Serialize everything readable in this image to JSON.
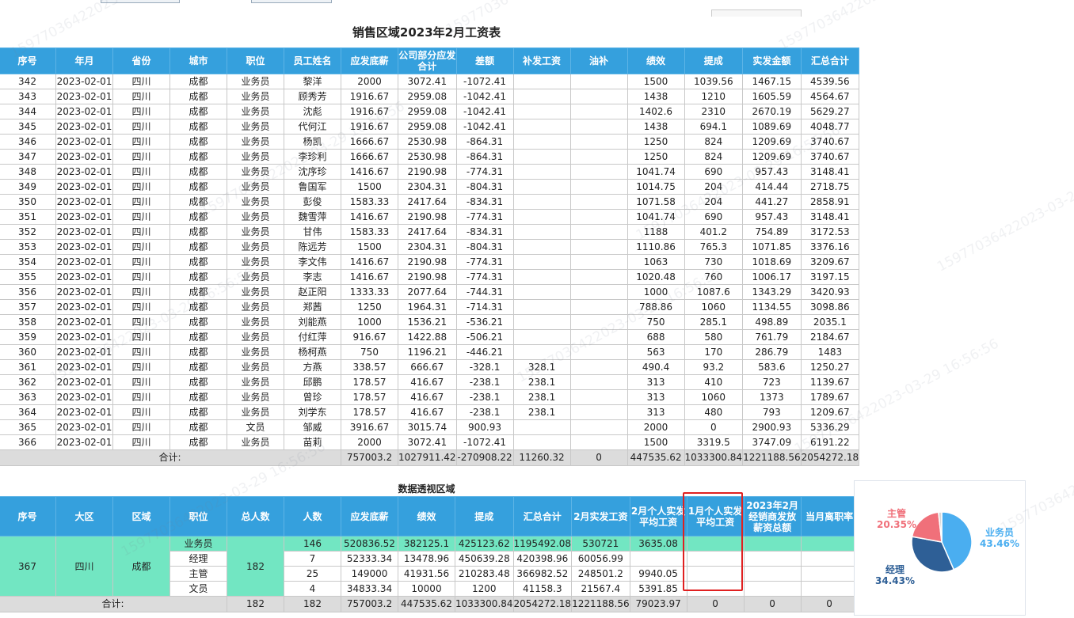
{
  "report_title": "销售区域2023年2月工资表",
  "pivot_title": "数据透视区域",
  "main": {
    "headers": [
      "序号",
      "年月",
      "省份",
      "城市",
      "职位",
      "员工姓名",
      "应发底薪",
      "公司部分应发合计",
      "差额",
      "补发工资",
      "油补",
      "绩效",
      "提成",
      "实发金额",
      "汇总合计"
    ],
    "rows": [
      [
        "342",
        "2023-02-01",
        "四川",
        "成都",
        "业务员",
        "黎洋",
        "2000",
        "3072.41",
        "-1072.41",
        "",
        "",
        "1500",
        "1039.56",
        "1467.15",
        "4539.56"
      ],
      [
        "343",
        "2023-02-01",
        "四川",
        "成都",
        "业务员",
        "顾秀芳",
        "1916.67",
        "2959.08",
        "-1042.41",
        "",
        "",
        "1438",
        "1210",
        "1605.59",
        "4564.67"
      ],
      [
        "344",
        "2023-02-01",
        "四川",
        "成都",
        "业务员",
        "沈彪",
        "1916.67",
        "2959.08",
        "-1042.41",
        "",
        "",
        "1402.6",
        "2310",
        "2670.19",
        "5629.27"
      ],
      [
        "345",
        "2023-02-01",
        "四川",
        "成都",
        "业务员",
        "代何江",
        "1916.67",
        "2959.08",
        "-1042.41",
        "",
        "",
        "1438",
        "694.1",
        "1089.69",
        "4048.77"
      ],
      [
        "346",
        "2023-02-01",
        "四川",
        "成都",
        "业务员",
        "杨凯",
        "1666.67",
        "2530.98",
        "-864.31",
        "",
        "",
        "1250",
        "824",
        "1209.69",
        "3740.67"
      ],
      [
        "347",
        "2023-02-01",
        "四川",
        "成都",
        "业务员",
        "李珍利",
        "1666.67",
        "2530.98",
        "-864.31",
        "",
        "",
        "1250",
        "824",
        "1209.69",
        "3740.67"
      ],
      [
        "348",
        "2023-02-01",
        "四川",
        "成都",
        "业务员",
        "沈序珍",
        "1416.67",
        "2190.98",
        "-774.31",
        "",
        "",
        "1041.74",
        "690",
        "957.43",
        "3148.41"
      ],
      [
        "349",
        "2023-02-01",
        "四川",
        "成都",
        "业务员",
        "鲁国军",
        "1500",
        "2304.31",
        "-804.31",
        "",
        "",
        "1014.75",
        "204",
        "414.44",
        "2718.75"
      ],
      [
        "350",
        "2023-02-01",
        "四川",
        "成都",
        "业务员",
        "彭俊",
        "1583.33",
        "2417.64",
        "-834.31",
        "",
        "",
        "1071.58",
        "204",
        "441.27",
        "2858.91"
      ],
      [
        "351",
        "2023-02-01",
        "四川",
        "成都",
        "业务员",
        "魏雪萍",
        "1416.67",
        "2190.98",
        "-774.31",
        "",
        "",
        "1041.74",
        "690",
        "957.43",
        "3148.41"
      ],
      [
        "352",
        "2023-02-01",
        "四川",
        "成都",
        "业务员",
        "甘伟",
        "1583.33",
        "2417.64",
        "-834.31",
        "",
        "",
        "1188",
        "401.2",
        "754.89",
        "3172.53"
      ],
      [
        "353",
        "2023-02-01",
        "四川",
        "成都",
        "业务员",
        "陈远芳",
        "1500",
        "2304.31",
        "-804.31",
        "",
        "",
        "1110.86",
        "765.3",
        "1071.85",
        "3376.16"
      ],
      [
        "354",
        "2023-02-01",
        "四川",
        "成都",
        "业务员",
        "李文伟",
        "1416.67",
        "2190.98",
        "-774.31",
        "",
        "",
        "1063",
        "730",
        "1018.69",
        "3209.67"
      ],
      [
        "355",
        "2023-02-01",
        "四川",
        "成都",
        "业务员",
        "李志",
        "1416.67",
        "2190.98",
        "-774.31",
        "",
        "",
        "1020.48",
        "760",
        "1006.17",
        "3197.15"
      ],
      [
        "356",
        "2023-02-01",
        "四川",
        "成都",
        "业务员",
        "赵正阳",
        "1333.33",
        "2077.64",
        "-744.31",
        "",
        "",
        "1000",
        "1087.6",
        "1343.29",
        "3420.93"
      ],
      [
        "357",
        "2023-02-01",
        "四川",
        "成都",
        "业务员",
        "郑茜",
        "1250",
        "1964.31",
        "-714.31",
        "",
        "",
        "788.86",
        "1060",
        "1134.55",
        "3098.86"
      ],
      [
        "358",
        "2023-02-01",
        "四川",
        "成都",
        "业务员",
        "刘能燕",
        "1000",
        "1536.21",
        "-536.21",
        "",
        "",
        "750",
        "285.1",
        "498.89",
        "2035.1"
      ],
      [
        "359",
        "2023-02-01",
        "四川",
        "成都",
        "业务员",
        "付红萍",
        "916.67",
        "1422.88",
        "-506.21",
        "",
        "",
        "688",
        "580",
        "761.79",
        "2184.67"
      ],
      [
        "360",
        "2023-02-01",
        "四川",
        "成都",
        "业务员",
        "杨柯燕",
        "750",
        "1196.21",
        "-446.21",
        "",
        "",
        "563",
        "170",
        "286.79",
        "1483"
      ],
      [
        "361",
        "2023-02-01",
        "四川",
        "成都",
        "业务员",
        "方燕",
        "338.57",
        "666.67",
        "-328.1",
        "328.1",
        "",
        "490.4",
        "93.2",
        "583.6",
        "1250.27"
      ],
      [
        "362",
        "2023-02-01",
        "四川",
        "成都",
        "业务员",
        "邱鹏",
        "178.57",
        "416.67",
        "-238.1",
        "238.1",
        "",
        "313",
        "410",
        "723",
        "1139.67"
      ],
      [
        "363",
        "2023-02-01",
        "四川",
        "成都",
        "业务员",
        "曾珍",
        "178.57",
        "416.67",
        "-238.1",
        "238.1",
        "",
        "313",
        "1060",
        "1373",
        "1789.67"
      ],
      [
        "364",
        "2023-02-01",
        "四川",
        "成都",
        "业务员",
        "刘学东",
        "178.57",
        "416.67",
        "-238.1",
        "238.1",
        "",
        "313",
        "480",
        "793",
        "1209.67"
      ],
      [
        "365",
        "2023-02-01",
        "四川",
        "成都",
        "文员",
        "邹威",
        "3916.67",
        "3015.74",
        "900.93",
        "",
        "",
        "2000",
        "0",
        "2900.93",
        "5336.29"
      ],
      [
        "366",
        "2023-02-01",
        "四川",
        "成都",
        "业务员",
        "苗莉",
        "2000",
        "3072.41",
        "-1072.41",
        "",
        "",
        "1500",
        "3319.5",
        "3747.09",
        "6191.22"
      ]
    ],
    "total_label": "合计:",
    "totals": [
      "757003.2",
      "1027911.42",
      "-270908.22",
      "11260.32",
      "0",
      "447535.62",
      "1033300.84",
      "1221188.56",
      "2054272.18"
    ]
  },
  "pivot": {
    "headers": [
      "序号",
      "大区",
      "区域",
      "职位",
      "总人数",
      "人数",
      "应发底薪",
      "绩效",
      "提成",
      "汇总合计",
      "2月实发工资",
      "2月个人实发平均工资",
      "1月个人实发平均工资",
      "2023年2月经销商发放薪资总额",
      "当月离职率"
    ],
    "group": {
      "seq": "367",
      "region_big": "四川",
      "region": "成都",
      "total_people": "182"
    },
    "rows": [
      {
        "position": "业务员",
        "count": "146",
        "base": "520836.52",
        "perf": "382125.1",
        "comm": "425123.62",
        "sum": "1195492.08",
        "feb_paid": "530721",
        "feb_avg": "3635.08"
      },
      {
        "position": "经理",
        "count": "7",
        "base": "52333.34",
        "perf": "13478.96",
        "comm": "450639.28",
        "sum": "420398.96",
        "feb_paid": "60056.99",
        "feb_avg": ""
      },
      {
        "position": "主管",
        "count": "25",
        "base": "149000",
        "perf": "41931.56",
        "comm": "210283.48",
        "sum": "366982.52",
        "feb_paid": "248501.2",
        "feb_avg": "9940.05"
      },
      {
        "position": "文员",
        "count": "4",
        "base": "34833.34",
        "perf": "10000",
        "comm": "1200",
        "sum": "41158.3",
        "feb_paid": "21567.4",
        "feb_avg": "5391.85"
      }
    ],
    "total_label": "合计:",
    "totals": [
      "182",
      "182",
      "757003.2",
      "447535.62",
      "1033300.84",
      "2054272.18",
      "1221188.56",
      "79023.97",
      "0",
      "0",
      "0"
    ]
  },
  "chart_data": {
    "type": "pie",
    "slices": [
      {
        "label": "业务员",
        "value": 43.46,
        "display": "43.46%",
        "color": "#4aaef0"
      },
      {
        "label": "经理",
        "value": 34.43,
        "display": "34.43%",
        "color": "#2e5f96"
      },
      {
        "label": "主管",
        "value": 20.35,
        "display": "20.35%",
        "color": "#f0707a"
      },
      {
        "label": "",
        "value": 1.76,
        "display": "",
        "color": "#d8d8d8"
      }
    ]
  },
  "watermarks": [
    "15977036422023-03-29 16:56:56",
    "15977036422023-03-29 16:56:56",
    "15977036422023-03-29 16:56:56",
    "15977036422023-03-29 16:56:56",
    "15977036422023-03-29 16:56:56",
    "15977036422023-03-29 16:56:56"
  ],
  "colors": {
    "header": "#35a0dd",
    "group": "#72e6c2",
    "total_row": "#dcdcdc",
    "highlight": "#e02020"
  }
}
